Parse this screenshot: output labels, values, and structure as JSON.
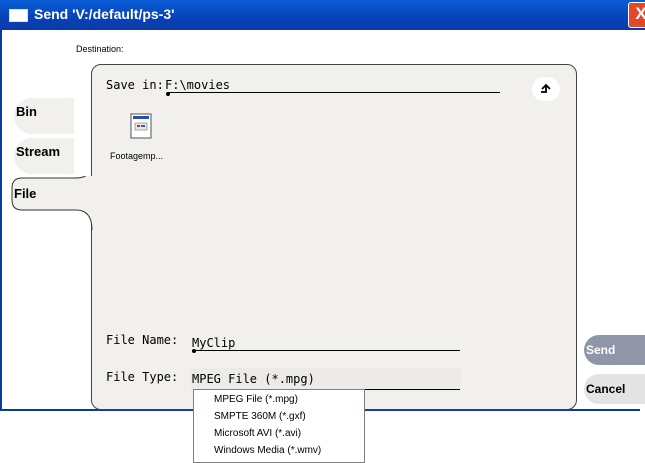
{
  "window": {
    "title": "Send 'V:/default/ps-3'",
    "close_glyph": "X"
  },
  "destination_label": "Destination:",
  "tabs": [
    {
      "label": "Bin"
    },
    {
      "label": "Stream"
    },
    {
      "label": "File"
    }
  ],
  "save_in": {
    "label": "Save in:",
    "value": "F:\\movies"
  },
  "files": [
    {
      "name": "Footagemp...",
      "icon": "media-file-icon"
    }
  ],
  "file_name": {
    "label": "File Name:",
    "value": "MyClip"
  },
  "file_type": {
    "label": "File Type:",
    "value": "MPEG File (*.mpg)",
    "options": [
      "MPEG File (*.mpg)",
      "SMPTE 360M (*.gxf)",
      "Microsoft AVI (*.avi)",
      "Windows Media (*.wmv)"
    ]
  },
  "buttons": {
    "send": "Send",
    "cancel": "Cancel"
  },
  "colors": {
    "titlebar": "#0742b8",
    "panel": "#f1f0ed",
    "send_button": "#8e96a8"
  }
}
